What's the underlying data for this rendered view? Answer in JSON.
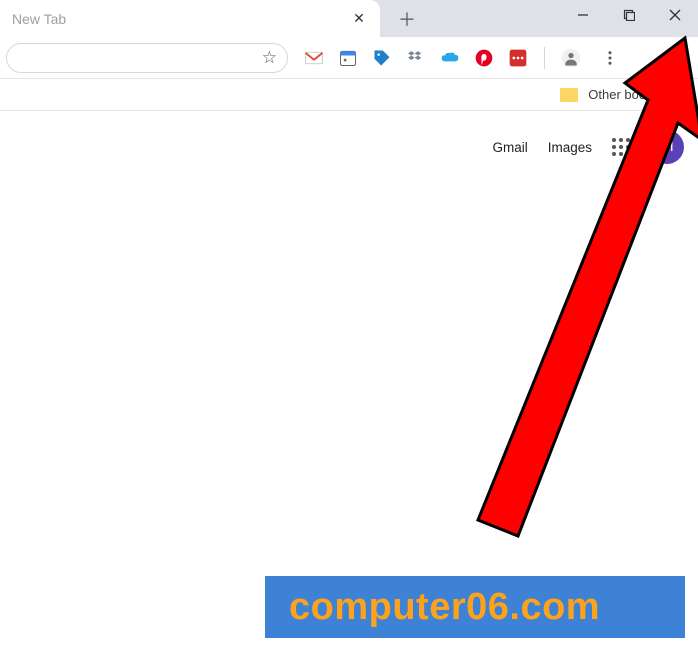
{
  "tab": {
    "title": "New Tab"
  },
  "bookmarks": {
    "other_label": "Other bookmarks"
  },
  "ntp": {
    "gmail_label": "Gmail",
    "images_label": "Images",
    "avatar_initial": "M"
  },
  "extensions": {
    "gmail": "gmail-icon",
    "calendar": "calendar-icon",
    "saved": "saved-icon",
    "dropbox": "dropbox-icon",
    "onedrive": "onedrive-icon",
    "pinterest": "pinterest-icon",
    "lastpass": "lastpass-icon"
  },
  "watermark": {
    "text": "computer06.com"
  },
  "colors": {
    "titlebar": "#DEE1E6",
    "accent_avatar": "#5B40B8",
    "pinterest": "#E60023",
    "lastpass": "#D32F2F",
    "onedrive": "#28A8EA",
    "watermark_bg": "#3E82D5",
    "watermark_fg": "#FDA21D",
    "arrow": "#FF0000"
  }
}
